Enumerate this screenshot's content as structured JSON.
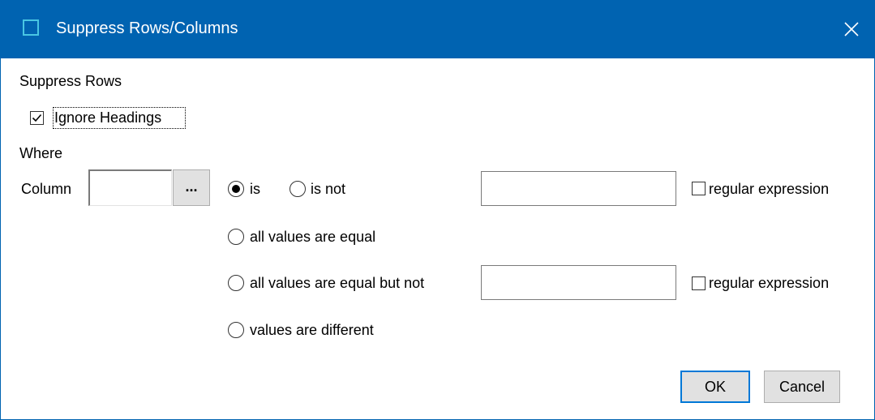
{
  "window": {
    "title": "Suppress Rows/Columns",
    "close_icon": "close-icon",
    "accent_color": "#0063b1"
  },
  "form": {
    "section_label": "Suppress Rows",
    "ignore_headings": {
      "label": "Ignore Headings",
      "checked": true
    },
    "where_label": "Where",
    "column_label": "Column",
    "column_value": "",
    "browse_label": "...",
    "options": {
      "is": {
        "label": "is",
        "selected": true
      },
      "is_not": {
        "label": "is not",
        "selected": false
      },
      "all_equal": {
        "label": "all values are equal",
        "selected": false
      },
      "all_equal_but_not": {
        "label": "all values are equal but not",
        "selected": false
      },
      "different": {
        "label": "values are different",
        "selected": false
      }
    },
    "value_input": "",
    "but_not_input": "",
    "regex_1": {
      "label": "regular expression",
      "checked": false
    },
    "regex_2": {
      "label": "regular expression",
      "checked": false
    }
  },
  "buttons": {
    "ok": "OK",
    "cancel": "Cancel"
  }
}
